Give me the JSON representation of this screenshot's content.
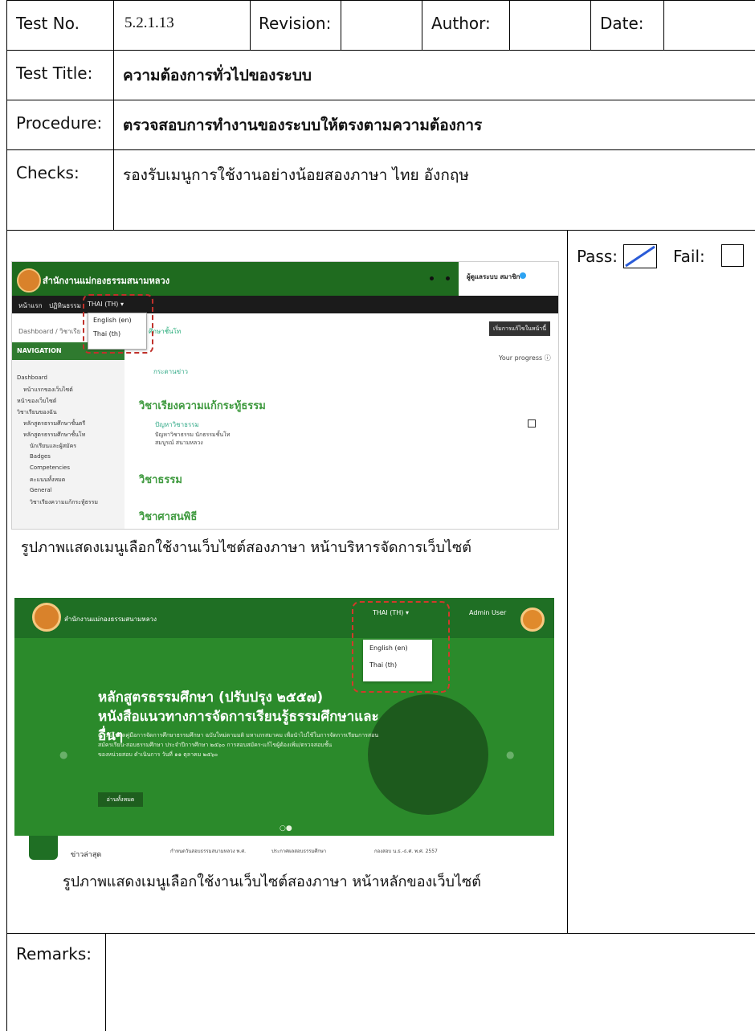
{
  "header": {
    "test_no_label": "Test No.",
    "test_no_value": "5.2.1.13",
    "revision_label": "Revision:",
    "author_label": "Author:",
    "date_label": "Date:"
  },
  "rows": {
    "title_label": "Test Title:",
    "title_value": "ความต้องการทั่วไปของระบบ",
    "procedure_label": "Procedure:",
    "procedure_value": "ตรวจสอบการทำงานของระบบให้ตรงตามความต้องการ",
    "checks_label": "Checks:",
    "checks_value": "รองรับเมนูการใช้งานอย่างน้อยสองภาษา ไทย อังกฤษ",
    "remarks_label": "Remarks:"
  },
  "result": {
    "pass_label": "Pass:",
    "fail_label": "Fail:",
    "pass_checked": true,
    "fail_checked": false,
    "mark_color": "#2a5bd7"
  },
  "screenshot1": {
    "site_title": "สำนักงานแม่กองธรรมสนามหลวง",
    "admin_name": "ผู้ดูแลระบบ สมาชิก",
    "nav_items": [
      "หน้าแรก",
      "ปฏิทินธรรม",
      "THAI (TH) ▾"
    ],
    "dropdown": [
      "English (en)",
      "Thai (th)"
    ],
    "breadcrumb": "Dashboard  /  วิชาเรีย",
    "breadcrumb_right": "ศึกษาชั้นโท",
    "button": "เริ่มการแก้ไขในหน้านี้",
    "nav_header": "NAVIGATION",
    "side_items": [
      "Dashboard",
      "หน้าแรกของเว็บไซต์",
      "หน้าของเว็บไซต์",
      "วิชาเรียนของฉัน",
      "หลักสูตรธรรมศึกษาชั้นตรี",
      "หลักสูตรธรรมศึกษาชั้นโท",
      "นักเรียนและผู้สมัคร",
      "Badges",
      "Competencies",
      "คะแนนทั้งหมด",
      "General",
      "วิชาเรียงความแก้กระทู้ธรรม"
    ],
    "forum": "กระดานข่าว",
    "section1": "วิชาเรียงความแก้กระทู้ธรรม",
    "item1": "ปัญหาวิชาธรรม",
    "item1_sub1": "ปัญหาวิชาธรรม นักธรรมชั้นโท",
    "item1_sub2": "สมบูรณ์ สนามหลวง",
    "section2": "วิชาธรรม",
    "section3": "วิชาศาสนพิธี",
    "progress": "Your progress ⓘ",
    "accent": "#1f6b1f"
  },
  "caption1": "รูปภาพแสดงเมนูเลือกใช้งานเว็บไซต์สองภาษา หน้าบริหารจัดการเว็บไซต์",
  "screenshot2": {
    "site_title": "สำนักงานแม่กองธรรมสนามหลวง",
    "lang_selector": "THAI (TH) ▾",
    "admin_user": "Admin User",
    "dropdown": [
      "English (en)",
      "Thai (th)"
    ],
    "heading1": "หลักสูตรธรรมศึกษา (ปรับปรุง ๒๕๕๗)",
    "heading2": "หนังสือแนวทางการจัดการเรียนรู้ธรรมศึกษาและ",
    "heading3": "อื่นๆ",
    "desc1": "ดาวน์โหลดคู่มือการจัดการศึกษาธรรมศึกษา ฉบับใหม่ตามมติ มหาเถรสมาคม เพื่อนำไปใช้ในการจัดการเรียนการสอน",
    "desc2": "สมัครเรียน-สอบธรรมศึกษา ประจำปีการศึกษา ๒๕๖๐ การสอบสมัคร-แก้ไขผู้ต้องเพิ่ม/ตรวจสอบชั้น",
    "desc3": "ของหน่วยสอบ ดำเนินการ วันที่ ๑๑ ตุลาคม ๒๕๖๐",
    "button": "อ่านทั้งหมด",
    "news_label": "ข่าวล่าสุด",
    "news_items": [
      "กำหนดวันสอบธรรมสนามหลวง พ.ศ.",
      "ประกาศผลสอบธรรมศึกษา",
      "กองสอบ น.ธ.-ธ.ศ. พ.ศ. 2557"
    ],
    "accent": "#2b8a2b"
  },
  "caption2": "รูปภาพแสดงเมนูเลือกใช้งานเว็บไซต์สองภาษา หน้าหลักของเว็บไซต์"
}
